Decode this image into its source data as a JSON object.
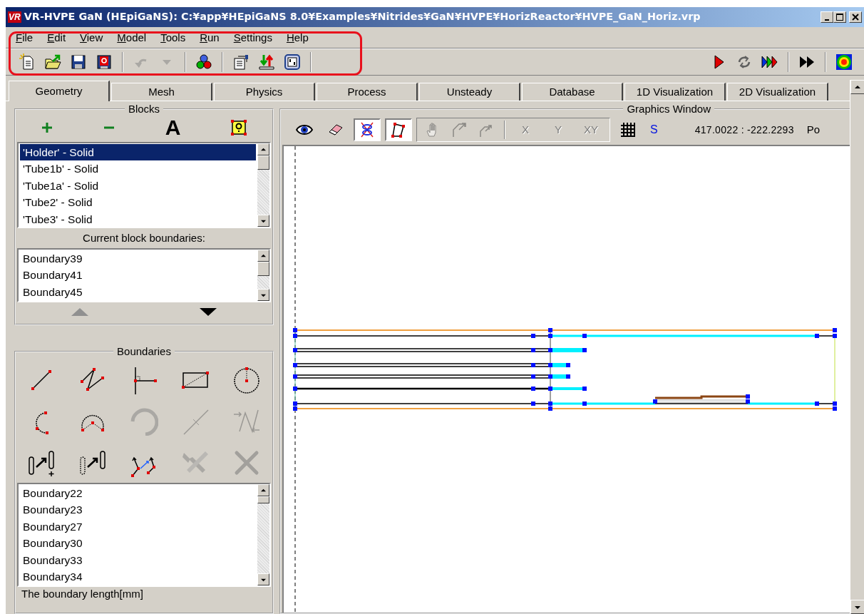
{
  "window": {
    "logo": "VR",
    "title": "VR-HVPE GaN (HEpiGaNS): C:¥app¥HEpiGaNS 8.0¥Examples¥Nitrides¥GaN¥HVPE¥HorizReactor¥HVPE_GaN_Horiz.vrp"
  },
  "menu": [
    {
      "label": "File"
    },
    {
      "label": "Edit"
    },
    {
      "label": "View"
    },
    {
      "label": "Model"
    },
    {
      "label": "Tools"
    },
    {
      "label": "Run"
    },
    {
      "label": "Settings"
    },
    {
      "label": "Help"
    }
  ],
  "toolbar": [
    {
      "kind": "new",
      "disabled": false
    },
    {
      "kind": "open",
      "disabled": false
    },
    {
      "kind": "save",
      "disabled": false
    },
    {
      "kind": "save-help",
      "disabled": false
    },
    {
      "kind": "separator"
    },
    {
      "kind": "undo",
      "disabled": true
    },
    {
      "kind": "dropdown",
      "disabled": true
    },
    {
      "kind": "separator"
    },
    {
      "kind": "circles",
      "disabled": false
    },
    {
      "kind": "separator"
    },
    {
      "kind": "properties",
      "disabled": false
    },
    {
      "kind": "transfer",
      "disabled": false
    },
    {
      "kind": "panel",
      "disabled": false
    },
    {
      "kind": "separator"
    }
  ],
  "run_toolbar": [
    {
      "kind": "play"
    },
    {
      "kind": "cycle"
    },
    {
      "kind": "multi-play"
    },
    {
      "kind": "separator"
    },
    {
      "kind": "fast-forward"
    },
    {
      "kind": "separator"
    },
    {
      "kind": "color-map"
    }
  ],
  "tabs": [
    {
      "label": "Geometry",
      "selected": true
    },
    {
      "label": "Mesh",
      "selected": false
    },
    {
      "label": "Physics",
      "selected": false
    },
    {
      "label": "Process",
      "selected": false
    },
    {
      "label": "Unsteady",
      "selected": false
    },
    {
      "label": "Database",
      "selected": false
    },
    {
      "label": "1D Visualization",
      "selected": false
    },
    {
      "label": "2D Visualization",
      "selected": false
    }
  ],
  "blocks": {
    "title": "Blocks",
    "actions": [
      {
        "kind": "plus"
      },
      {
        "kind": "minus"
      },
      {
        "kind": "glyph",
        "glyph": "A"
      },
      {
        "kind": "help"
      }
    ],
    "items": [
      {
        "label": "'Holder' - Solid",
        "selected": true
      },
      {
        "label": "'Tube1b' - Solid",
        "selected": false
      },
      {
        "label": "'Tube1a' - Solid",
        "selected": false
      },
      {
        "label": "'Tube2' - Solid",
        "selected": false
      },
      {
        "label": "'Tube3' - Solid",
        "selected": false
      }
    ],
    "boundaries_label": "Current block boundaries:",
    "boundaries": [
      "Boundary39",
      "Boundary41",
      "Boundary45"
    ],
    "reorder_buttons": [
      {
        "kind": "up",
        "disabled": true
      },
      {
        "kind": "down",
        "disabled": false
      }
    ]
  },
  "boundaries_panel": {
    "title": "Boundaries",
    "tools": [
      {
        "kind": "line",
        "disabled": false
      },
      {
        "kind": "polyline",
        "disabled": false
      },
      {
        "kind": "perpendicular",
        "disabled": false
      },
      {
        "kind": "rectangle",
        "disabled": false
      },
      {
        "kind": "circle",
        "disabled": false
      },
      {
        "kind": "arc",
        "disabled": false
      },
      {
        "kind": "arc3",
        "disabled": false
      },
      {
        "kind": "thick-arc",
        "disabled": true
      },
      {
        "kind": "split",
        "disabled": true
      },
      {
        "kind": "move-points",
        "disabled": true
      },
      {
        "kind": "copy-shape",
        "disabled": false
      },
      {
        "kind": "move-shape",
        "disabled": false
      },
      {
        "kind": "mirror",
        "disabled": false
      },
      {
        "kind": "tools",
        "disabled": true
      },
      {
        "kind": "delete",
        "disabled": true
      }
    ],
    "items": [
      "Boundary22",
      "Boundary23",
      "Boundary27",
      "Boundary30",
      "Boundary33",
      "Boundary34"
    ],
    "length_label": "The boundary length[mm]"
  },
  "graphics": {
    "title": "Graphics Window",
    "tools": [
      {
        "kind": "eye"
      },
      {
        "kind": "eraser"
      },
      {
        "kind": "mesh-toggle",
        "checked": true
      },
      {
        "kind": "shape-toggle",
        "checked": true
      }
    ],
    "nav_tools": [
      {
        "kind": "hand",
        "disabled": true
      },
      {
        "kind": "zoom-box",
        "disabled": true
      },
      {
        "kind": "zoom-step",
        "disabled": true
      },
      {
        "kind": "separator"
      },
      {
        "kind": "text",
        "label": "X",
        "disabled": true
      },
      {
        "kind": "text",
        "label": "Y",
        "disabled": true
      },
      {
        "kind": "text",
        "label": "XY",
        "disabled": true
      }
    ],
    "snap_label": "S",
    "coordinates": "417.0022 : -222.2293",
    "cut_label": "Po"
  }
}
